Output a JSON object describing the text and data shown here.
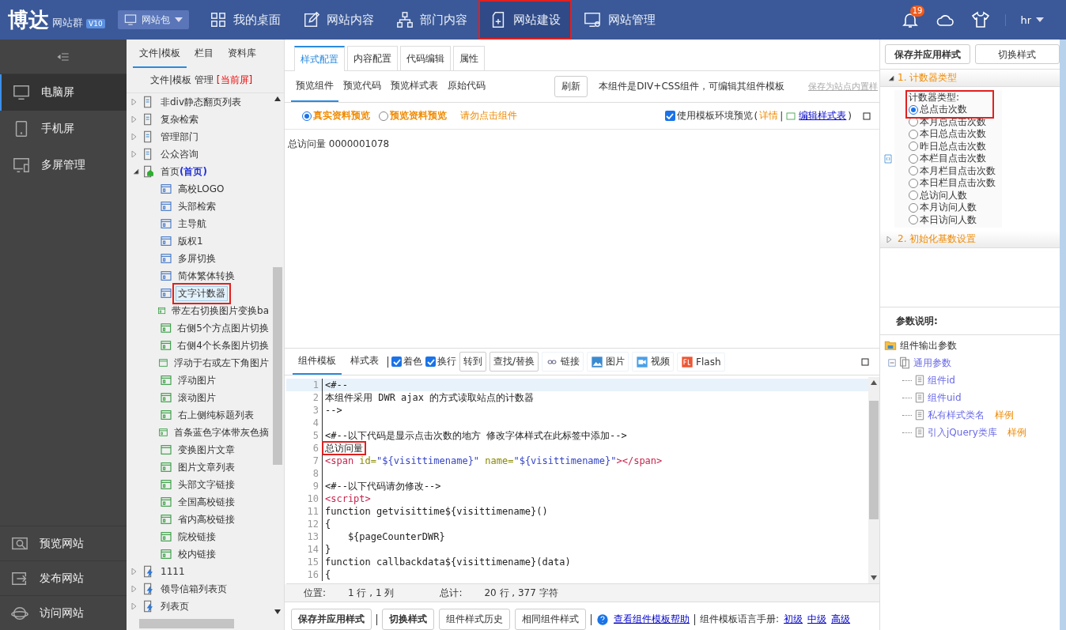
{
  "topbar": {
    "logo": "博达",
    "logo_sub": "网站群",
    "version": "V10",
    "site_select": "网站包",
    "nav": [
      {
        "label": "我的桌面",
        "selected": false,
        "highlighted": false
      },
      {
        "label": "网站内容",
        "selected": false,
        "highlighted": false
      },
      {
        "label": "部门内容",
        "selected": false,
        "highlighted": false
      },
      {
        "label": "网站建设",
        "selected": true,
        "highlighted": true
      },
      {
        "label": "网站管理",
        "selected": false,
        "highlighted": false
      }
    ],
    "notifications": "19",
    "user": "hr"
  },
  "sidebar": {
    "items": [
      {
        "label": "电脑屏",
        "selected": true
      },
      {
        "label": "手机屏",
        "selected": false
      },
      {
        "label": "多屏管理",
        "selected": false
      }
    ],
    "bottom_items": [
      {
        "label": "预览网站"
      },
      {
        "label": "发布网站"
      },
      {
        "label": "访问网站"
      }
    ]
  },
  "tree_panel": {
    "tabs": [
      {
        "label": "文件|模板",
        "selected": true
      },
      {
        "label": "栏目",
        "selected": false
      },
      {
        "label": "资料库",
        "selected": false
      }
    ],
    "manage": "文件|模板 管理",
    "current": "[当前屏]",
    "items": [
      {
        "label": "非div静态翻页列表",
        "kind": "page",
        "expanded": false
      },
      {
        "label": "复杂检索",
        "kind": "page",
        "expanded": false
      },
      {
        "label": "管理部门",
        "kind": "page",
        "expanded": false
      },
      {
        "label": "公众咨询",
        "kind": "page",
        "expanded": false
      },
      {
        "label": "首页",
        "tag": "(首页)",
        "kind": "home",
        "expanded": true,
        "children": [
          {
            "label": "高校LOGO",
            "kind": "component",
            "selected": false,
            "highlighted": false
          },
          {
            "label": "头部检索",
            "kind": "component",
            "selected": false,
            "highlighted": false
          },
          {
            "label": "主导航",
            "kind": "component",
            "selected": false,
            "highlighted": false
          },
          {
            "label": "版权1",
            "kind": "component",
            "selected": false,
            "highlighted": false
          },
          {
            "label": "多屏切换",
            "kind": "component",
            "selected": false,
            "highlighted": false
          },
          {
            "label": "简体繁体转换",
            "kind": "component",
            "selected": false,
            "highlighted": false
          },
          {
            "label": "文字计数器",
            "kind": "component",
            "selected": true,
            "highlighted": true
          },
          {
            "label": "带左右切换图片变换ba",
            "kind": "shared",
            "selected": false,
            "highlighted": false
          },
          {
            "label": "右侧5个方点图片切换",
            "kind": "shared",
            "selected": false,
            "highlighted": false
          },
          {
            "label": "右侧4个长条图片切换",
            "kind": "shared",
            "selected": false,
            "highlighted": false
          },
          {
            "label": "浮动于右或左下角图片",
            "kind": "window",
            "selected": false,
            "highlighted": false
          },
          {
            "label": "浮动图片",
            "kind": "shared",
            "selected": false,
            "highlighted": false
          },
          {
            "label": "滚动图片",
            "kind": "shared",
            "selected": false,
            "highlighted": false
          },
          {
            "label": "右上侧纯标题列表",
            "kind": "shared",
            "selected": false,
            "highlighted": false
          },
          {
            "label": "首条蓝色字体带灰色摘",
            "kind": "shared",
            "selected": false,
            "highlighted": false
          },
          {
            "label": "变换图片文章",
            "kind": "window",
            "selected": false,
            "highlighted": false
          },
          {
            "label": "图片文章列表",
            "kind": "shared",
            "selected": false,
            "highlighted": false
          },
          {
            "label": "头部文字链接",
            "kind": "shared",
            "selected": false,
            "highlighted": false
          },
          {
            "label": "全国高校链接",
            "kind": "shared",
            "selected": false,
            "highlighted": false
          },
          {
            "label": "省内高校链接",
            "kind": "shared",
            "selected": false,
            "highlighted": false
          },
          {
            "label": "院校链接",
            "kind": "shared",
            "selected": false,
            "highlighted": false
          },
          {
            "label": "校内链接",
            "kind": "shared",
            "selected": false,
            "highlighted": false
          }
        ]
      },
      {
        "label": "1111",
        "kind": "dynamic",
        "expanded": false
      },
      {
        "label": "领导信箱列表页",
        "kind": "dynamic",
        "expanded": false
      },
      {
        "label": "列表页",
        "kind": "dynamic",
        "expanded": false
      }
    ]
  },
  "main": {
    "tabs": [
      {
        "label": "样式配置",
        "selected": true
      },
      {
        "label": "内容配置",
        "selected": false
      },
      {
        "label": "代码编辑",
        "selected": false
      },
      {
        "label": "属性",
        "selected": false
      }
    ],
    "subtabs": [
      {
        "label": "预览组件",
        "selected": true
      },
      {
        "label": "预览代码",
        "selected": false
      },
      {
        "label": "预览样式表",
        "selected": false
      },
      {
        "label": "原始代码",
        "selected": false
      }
    ],
    "refresh": "刷新",
    "note": "本组件是DIV+CSS组件，可编辑其组件模板",
    "save_builtin": "保存为站点内置样",
    "preview_modes": [
      {
        "label": "真实资料预览",
        "selected": true
      },
      {
        "label": "预览资料预览",
        "selected": false
      }
    ],
    "warning": "请勿点击组件",
    "use_env": {
      "label": "使用模板环境预览",
      "checked": true
    },
    "paren_open": "(",
    "details": "详情",
    "divider": "|",
    "edit_css": "编辑样式表",
    "paren_close": ")",
    "preview_text": "总访问量 0000001078",
    "editor_tabs": [
      {
        "label": "组件模板",
        "selected": true
      },
      {
        "label": "样式表",
        "selected": false
      }
    ],
    "toggles": [
      {
        "label": "着色",
        "checked": true
      },
      {
        "label": "换行",
        "checked": true
      }
    ],
    "tools": [
      {
        "label": "转到",
        "kind": "plain"
      },
      {
        "label": "查找/替换",
        "kind": "plain"
      },
      {
        "label": "链接",
        "kind": "link"
      },
      {
        "label": "图片",
        "kind": "image"
      },
      {
        "label": "视频",
        "kind": "video"
      },
      {
        "label": "Flash",
        "kind": "flash"
      }
    ],
    "code": [
      {
        "n": "1",
        "highlighted": false,
        "tokens": [
          {
            "kind": "text",
            "text": "<#--"
          }
        ]
      },
      {
        "n": "2",
        "highlighted": false,
        "tokens": [
          {
            "kind": "text",
            "text": "本组件采用 DWR ajax 的方式读取站点的计数器"
          }
        ]
      },
      {
        "n": "3",
        "highlighted": false,
        "tokens": [
          {
            "kind": "text",
            "text": "-->"
          }
        ]
      },
      {
        "n": "4"
      },
      {
        "n": "5",
        "highlighted": false,
        "tokens": [
          {
            "kind": "text",
            "text": "<#--以下代码是显示点击次数的地方 修改字体样式在此标签中添加-->"
          }
        ]
      },
      {
        "n": "6",
        "highlighted": true,
        "tokens": [
          {
            "kind": "text",
            "text": "总访问量"
          }
        ]
      },
      {
        "n": "7",
        "highlighted": false,
        "tokens": [
          {
            "kind": "tag",
            "text": "<span"
          },
          {
            "kind": "attr",
            "text": " id="
          },
          {
            "kind": "string",
            "text": "\"${visittimename}\""
          },
          {
            "kind": "attr",
            "text": " name="
          },
          {
            "kind": "string",
            "text": "\"${visittimename}\""
          },
          {
            "kind": "tag",
            "text": "></span>"
          }
        ]
      },
      {
        "n": "8"
      },
      {
        "n": "9",
        "highlighted": false,
        "tokens": [
          {
            "kind": "text",
            "text": "<#--以下代码请勿修改-->"
          }
        ]
      },
      {
        "n": "10",
        "highlighted": false,
        "tokens": [
          {
            "kind": "tag",
            "text": "<script>"
          }
        ]
      },
      {
        "n": "11",
        "highlighted": false,
        "tokens": [
          {
            "kind": "text",
            "text": "function getvisittime${visittimename}()"
          }
        ]
      },
      {
        "n": "12",
        "highlighted": false,
        "tokens": [
          {
            "kind": "text",
            "text": "{"
          }
        ]
      },
      {
        "n": "13",
        "highlighted": false,
        "tokens": [
          {
            "kind": "text",
            "text": "    ${pageCounterDWR}"
          }
        ]
      },
      {
        "n": "14",
        "highlighted": false,
        "tokens": [
          {
            "kind": "text",
            "text": "}"
          }
        ]
      },
      {
        "n": "15",
        "highlighted": false,
        "tokens": [
          {
            "kind": "text",
            "text": "function callbackdata${visittimename}(data)"
          }
        ]
      },
      {
        "n": "16",
        "highlighted": false,
        "tokens": [
          {
            "kind": "text",
            "text": "{"
          }
        ]
      }
    ],
    "status": {
      "position_label": "位置:",
      "position": "1 行 , 1 列",
      "total_label": "总计:",
      "total": "20 行 , 377 字符"
    },
    "bottom_buttons": [
      {
        "label": "保存并应用样式",
        "bold": true
      },
      {
        "label": "切换样式",
        "bold": true
      },
      {
        "label": "组件样式历史",
        "bold": false
      },
      {
        "label": "相同组件样式",
        "bold": false
      }
    ],
    "help_link": "查看组件模板帮助",
    "manual_label": "组件模板语言手册:",
    "manual_links": [
      "初级",
      "中级",
      "高级"
    ]
  },
  "right_panel": {
    "buttons": [
      "保存并应用样式",
      "切换样式"
    ],
    "sections": [
      {
        "title": "1. 计数器类型",
        "expanded": true,
        "field_label": "计数器类型:",
        "highlighted": true,
        "options": [
          {
            "label": "总点击次数",
            "selected": true
          },
          {
            "label": "本月总点击次数",
            "selected": false
          },
          {
            "label": "本日总点击次数",
            "selected": false
          },
          {
            "label": "昨日总点击次数",
            "selected": false
          },
          {
            "label": "本栏目点击次数",
            "selected": false
          },
          {
            "label": "本月栏目点击次数",
            "selected": false
          },
          {
            "label": "本日栏目点击次数",
            "selected": false
          },
          {
            "label": "总访问人数",
            "selected": false
          },
          {
            "label": "本月访问人数",
            "selected": false
          },
          {
            "label": "本日访问人数",
            "selected": false
          }
        ]
      },
      {
        "title": "2. 初始化基数设置",
        "expanded": false
      }
    ],
    "params_title": "参数说明:",
    "params": {
      "label": "组件输出参数",
      "children": [
        {
          "label": "通用参数",
          "children": [
            {
              "label": "组件id"
            },
            {
              "label": "组件uid"
            },
            {
              "label": "私有样式类名",
              "example": "样例"
            },
            {
              "label": "引入jQuery类库",
              "example": "样例"
            }
          ]
        }
      ]
    }
  }
}
